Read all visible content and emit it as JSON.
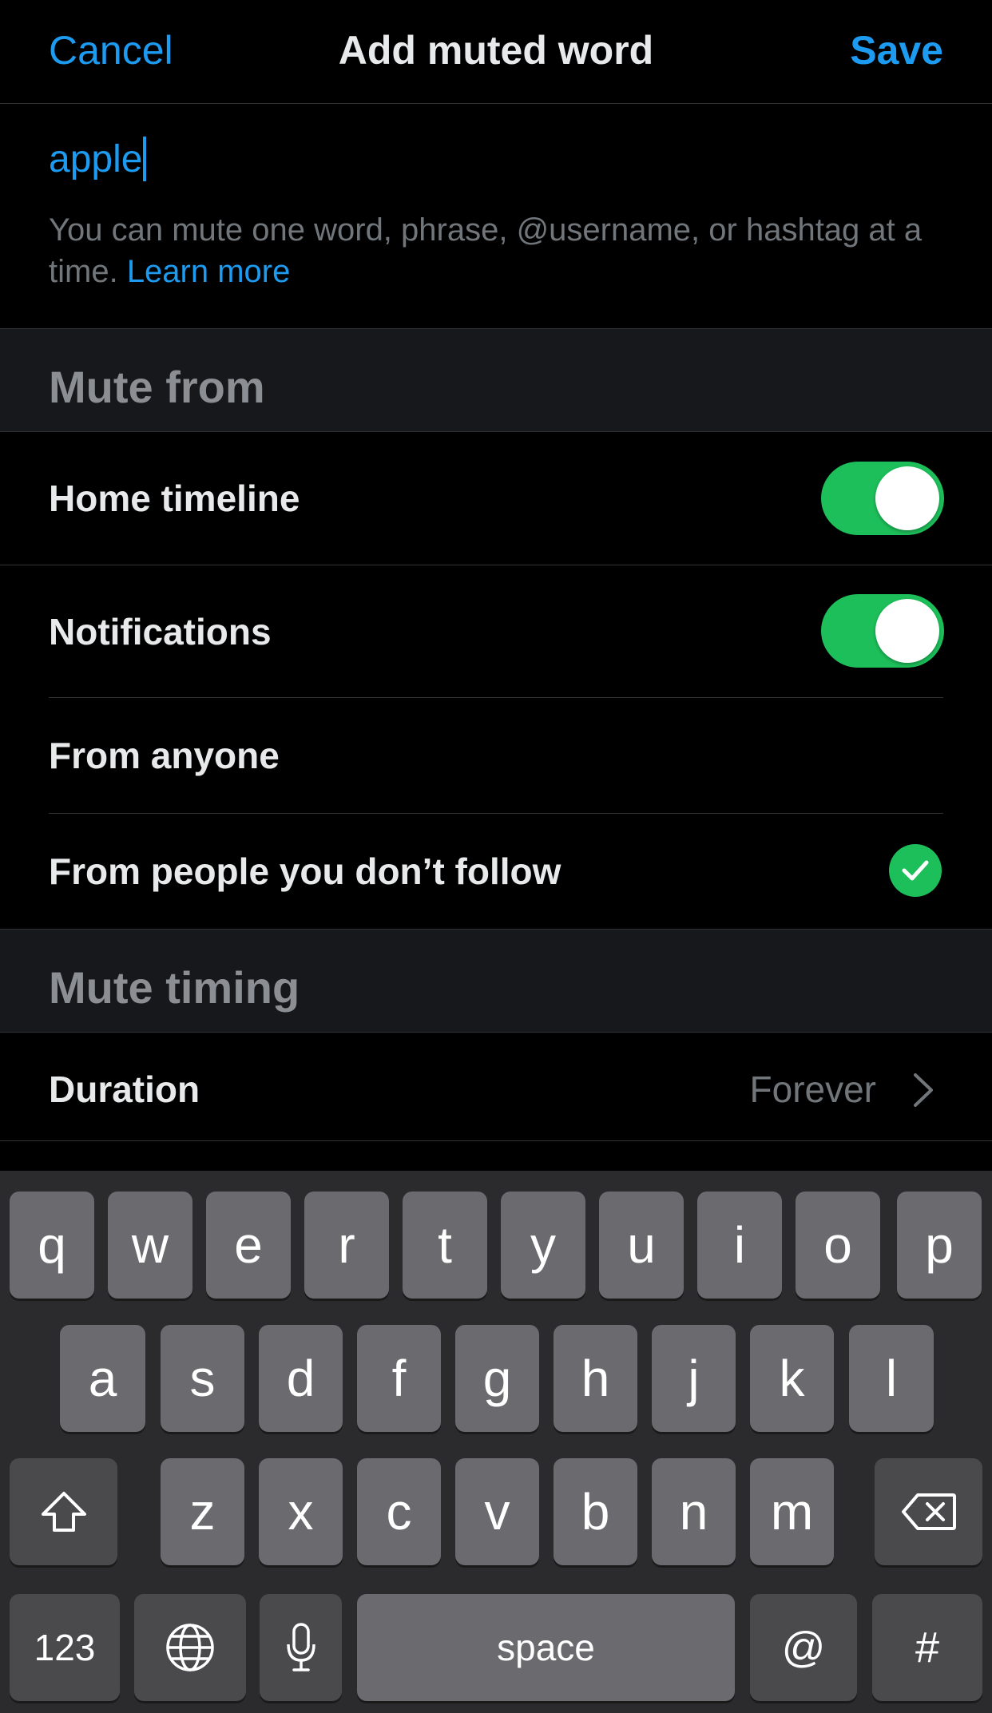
{
  "header": {
    "cancel_label": "Cancel",
    "title": "Add muted word",
    "save_label": "Save"
  },
  "input": {
    "value": "apple"
  },
  "helper": {
    "text": "You can mute one word, phrase, @username, or hashtag at a time.",
    "link": "Learn more"
  },
  "mute_from": {
    "title": "Mute from",
    "home_timeline": {
      "label": "Home timeline",
      "on": true
    },
    "notifications": {
      "label": "Notifications",
      "on": true
    },
    "from_anyone": {
      "label": "From anyone",
      "selected": false
    },
    "from_not_following": {
      "label": "From people you don’t follow",
      "selected": true
    }
  },
  "mute_timing": {
    "title": "Mute timing",
    "duration": {
      "label": "Duration",
      "value": "Forever"
    }
  },
  "keyboard": {
    "row1": [
      "q",
      "w",
      "e",
      "r",
      "t",
      "y",
      "u",
      "i",
      "o",
      "p"
    ],
    "row2": [
      "a",
      "s",
      "d",
      "f",
      "g",
      "h",
      "j",
      "k",
      "l"
    ],
    "row3": [
      "z",
      "x",
      "c",
      "v",
      "b",
      "n",
      "m"
    ],
    "numbers_label": "123",
    "space_label": "space",
    "at_label": "@",
    "hash_label": "#"
  },
  "colors": {
    "accent": "#1d9bf0",
    "toggle_on": "#1dbf5a",
    "background": "#000000",
    "section_bg": "#16181c"
  }
}
